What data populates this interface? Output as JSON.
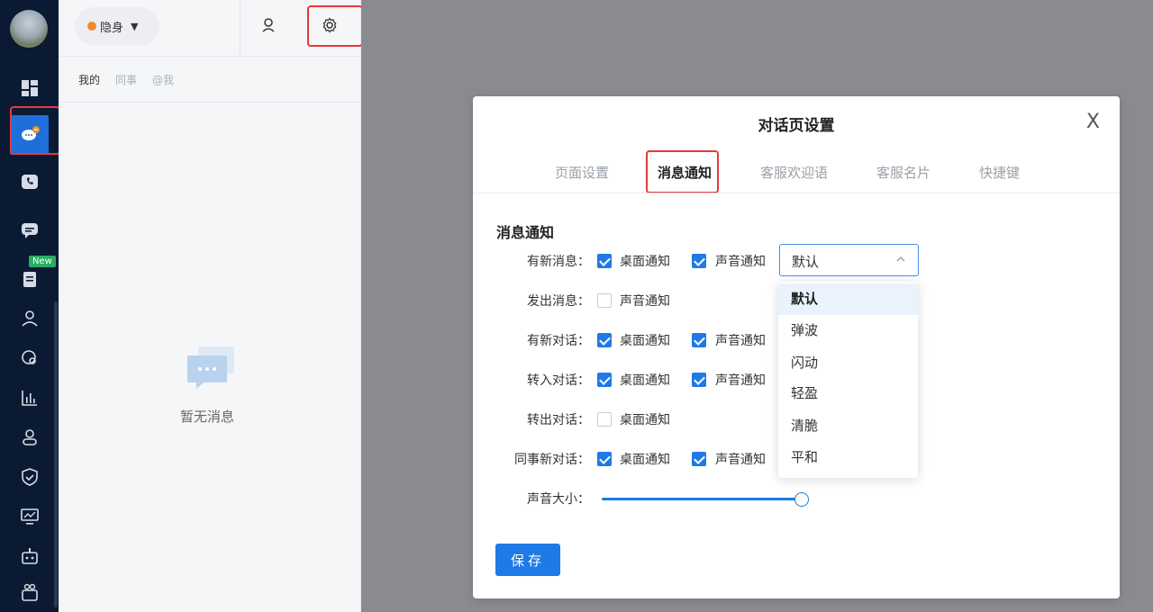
{
  "status": {
    "label": "隐身"
  },
  "list": {
    "tabs": [
      "我的",
      "同事",
      "@我"
    ],
    "empty_text": "暂无消息"
  },
  "rail": {
    "new_badge": "New"
  },
  "dialog": {
    "title": "对话页设置",
    "close": "X",
    "tabs": [
      "页面设置",
      "消息通知",
      "客服欢迎语",
      "客服名片",
      "快捷键"
    ],
    "active_tab": "消息通知",
    "section_title": "消息通知",
    "rows": [
      {
        "label": "有新消息：",
        "desktop": true,
        "sound": true
      },
      {
        "label": "发出消息：",
        "sound_only": false
      },
      {
        "label": "有新对话：",
        "desktop": true,
        "sound": true
      },
      {
        "label": "转入对话：",
        "desktop": true,
        "sound": true
      },
      {
        "label": "转出对话：",
        "desktop_only": false
      },
      {
        "label": "同事新对话：",
        "desktop": true,
        "sound": true
      }
    ],
    "desktop_notify": "桌面通知",
    "sound_notify": "声音通知",
    "volume_label": "声音大小：",
    "volume_level": 1.0,
    "sound_select": {
      "value": "默认",
      "options": [
        "默认",
        "弹波",
        "闪动",
        "轻盈",
        "清脆",
        "平和"
      ]
    },
    "save_label": "保存"
  },
  "colors": {
    "accent": "#1e7ae6",
    "rail_bg": "#0b1a33",
    "highlight_box": "#e4393c"
  }
}
